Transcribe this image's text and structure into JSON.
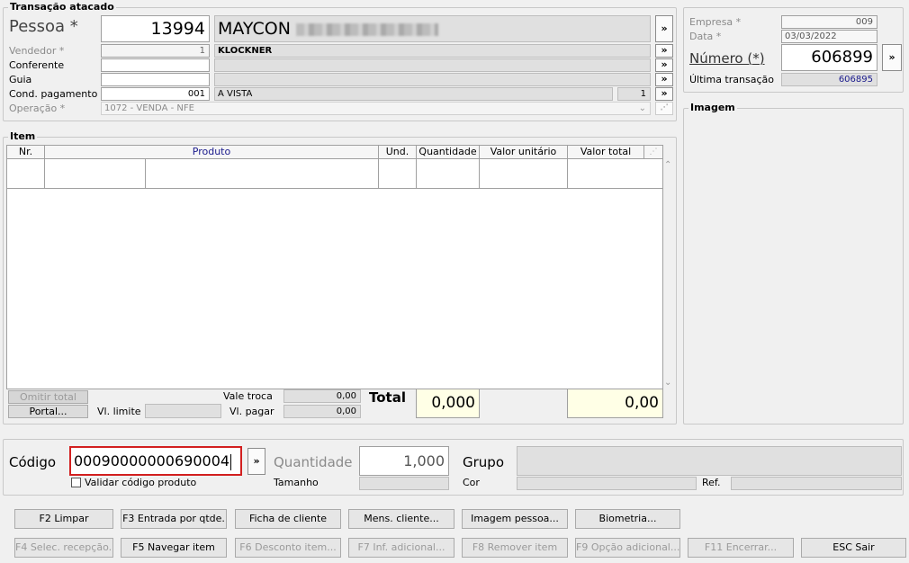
{
  "transacao": {
    "title": "Transação atacado",
    "pessoa_label": "Pessoa *",
    "pessoa_code": "13994",
    "pessoa_name": "MAYCON",
    "vendedor_label": "Vendedor *",
    "vendedor_code": "1",
    "vendedor_name": "KLOCKNER",
    "conferente_label": "Conferente",
    "guia_label": "Guia",
    "cond_label": "Cond. pagamento *",
    "cond_code": "001",
    "cond_name": "A VISTA",
    "cond_parcelas": "1",
    "operacao_label": "Operação *",
    "operacao_value": "1072 - VENDA - NFE",
    "arrow": "»"
  },
  "empresa": {
    "empresa_label": "Empresa *",
    "empresa_value": "009",
    "data_label": "Data *",
    "data_value": "03/03/2022",
    "numero_label": "Número (*)",
    "numero_value": "606899",
    "ultima_label": "Última transação",
    "ultima_value": "606895"
  },
  "imagem": {
    "title": "Imagem"
  },
  "item": {
    "title": "Item",
    "columns": [
      "Nr.",
      "Produto",
      "Und.",
      "Quantidade",
      "Valor unitário",
      "Valor total"
    ],
    "omitir_label": "Omitir total",
    "portal_label": "Portal...",
    "vl_limite_label": "Vl. limite",
    "vale_troca_label": "Vale troca",
    "vale_troca_value": "0,00",
    "vl_pagar_label": "Vl. pagar",
    "vl_pagar_value": "0,00",
    "total_label": "Total",
    "total_qtd": "0,000",
    "total_valor": "0,00"
  },
  "entrada": {
    "codigo_label": "Código",
    "codigo_value": "00090000000690004",
    "validar_label": "Validar código produto",
    "quantidade_label": "Quantidade",
    "quantidade_value": "1,000",
    "tamanho_label": "Tamanho",
    "grupo_label": "Grupo",
    "cor_label": "Cor",
    "ref_label": "Ref."
  },
  "buttons": {
    "row1": [
      "F2 Limpar",
      "F3 Entrada por qtde.",
      "Ficha de cliente",
      "Mens. cliente...",
      "Imagem pessoa...",
      "Biometria..."
    ],
    "row2": [
      "F4 Selec. recepção..",
      "F5 Navegar item",
      "F6 Desconto item...",
      "F7 Inf. adicional...",
      "F8 Remover item",
      "F9 Opção adicional...",
      "F11 Encerrar...",
      "ESC Sair"
    ]
  }
}
